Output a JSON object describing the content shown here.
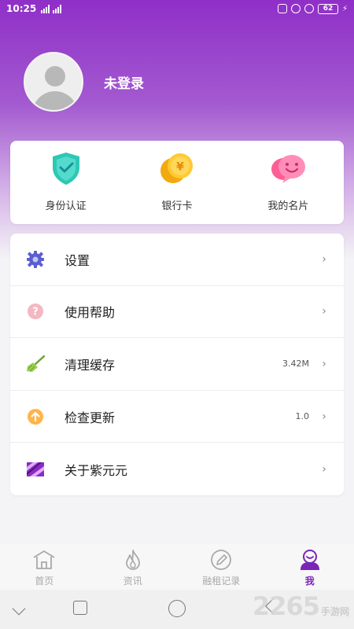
{
  "status_bar": {
    "time": "10:25",
    "battery": "62"
  },
  "profile": {
    "login_text": "未登录"
  },
  "quick_actions": [
    {
      "label": "身份认证",
      "icon": "shield-check-icon"
    },
    {
      "label": "银行卡",
      "icon": "coin-yen-icon"
    },
    {
      "label": "我的名片",
      "icon": "smile-chat-icon"
    }
  ],
  "menu": [
    {
      "label": "设置",
      "value": "",
      "icon": "gear-icon"
    },
    {
      "label": "使用帮助",
      "value": "",
      "icon": "help-icon"
    },
    {
      "label": "清理缓存",
      "value": "3.42M",
      "icon": "broom-icon"
    },
    {
      "label": "检查更新",
      "value": "1.0",
      "icon": "update-arrow-icon"
    },
    {
      "label": "关于紫元元",
      "value": "",
      "icon": "brand-logo-icon"
    }
  ],
  "tabs": [
    {
      "label": "首页",
      "icon": "home-icon",
      "active": false
    },
    {
      "label": "资讯",
      "icon": "flame-icon",
      "active": false
    },
    {
      "label": "融租记录",
      "icon": "pen-record-icon",
      "active": false
    },
    {
      "label": "我",
      "icon": "user-profile-icon",
      "active": true
    }
  ],
  "watermark": {
    "number": "2265",
    "text": "手游网"
  },
  "colors": {
    "accent": "#7b24b8",
    "header_top": "#8f2fc8",
    "inactive_tab": "#a9a9a9"
  }
}
